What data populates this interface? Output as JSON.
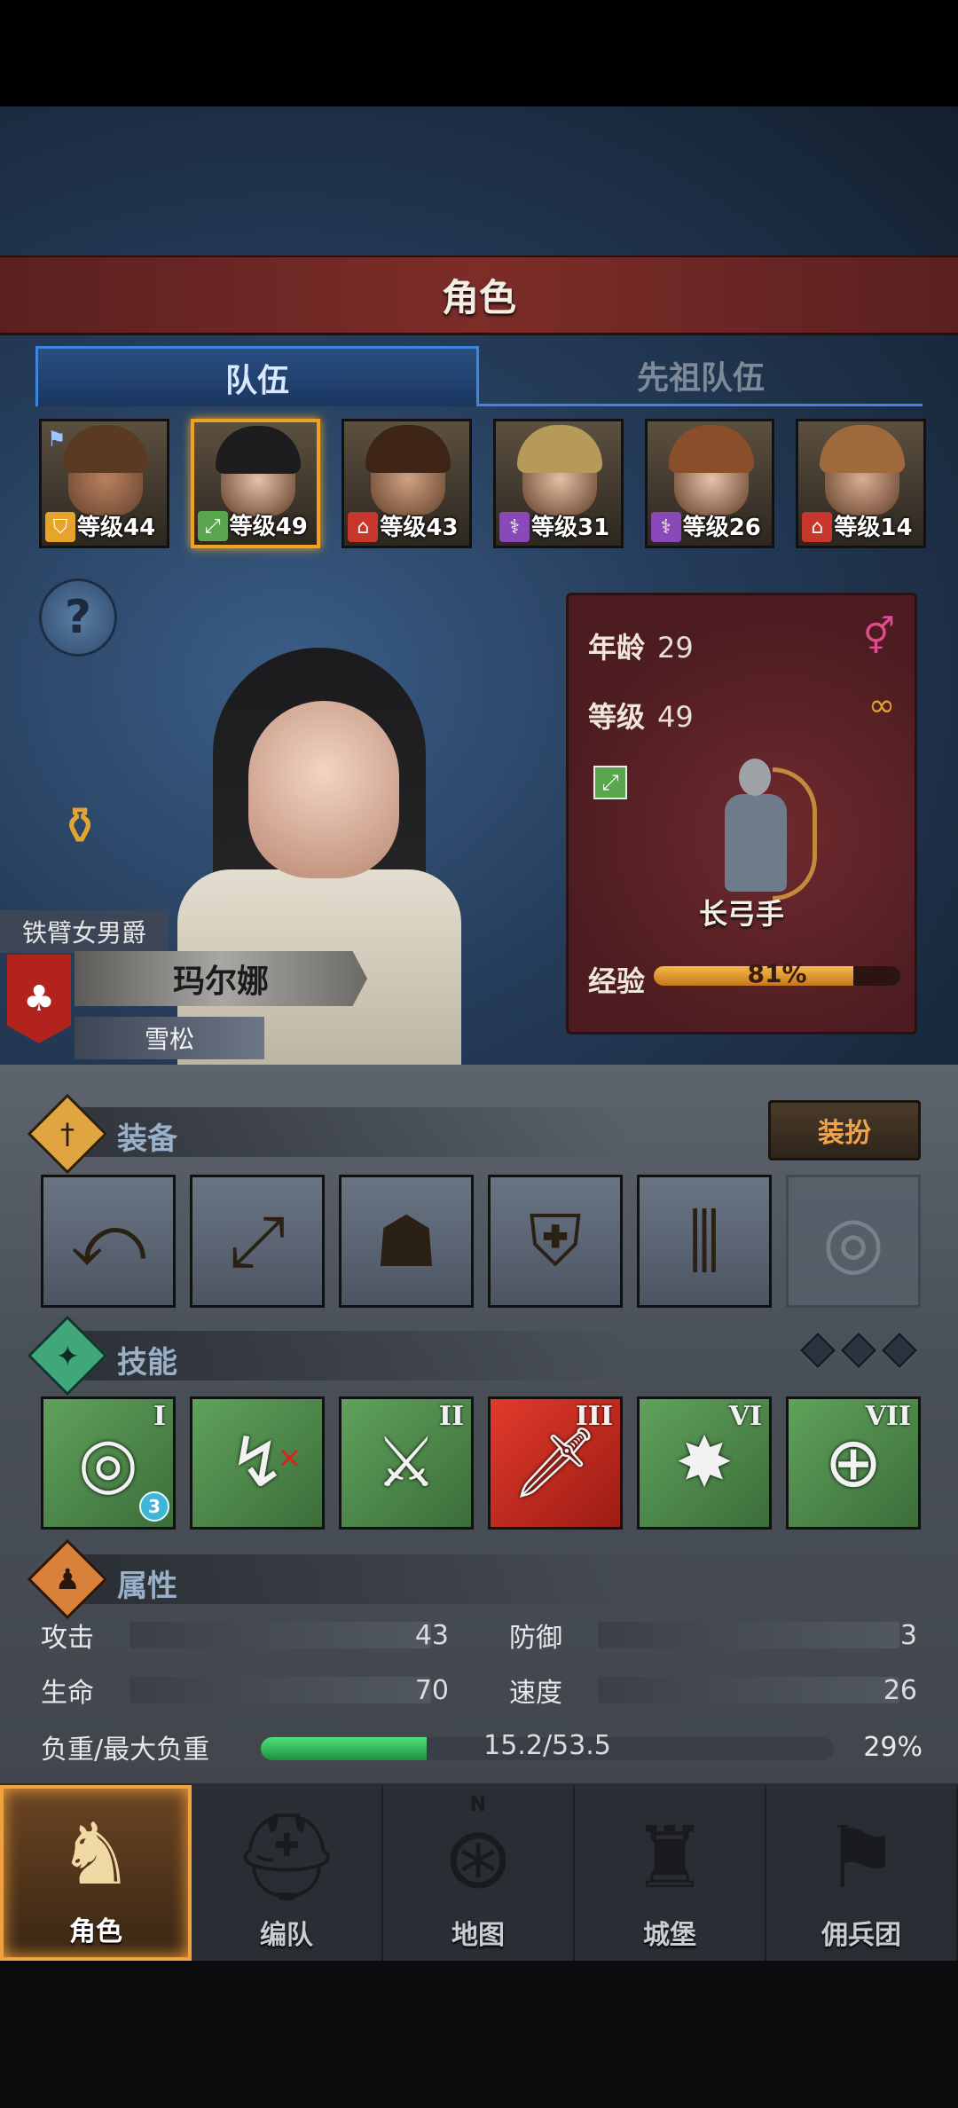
{
  "screen_title": "角色",
  "tabs": [
    {
      "label": "队伍",
      "active": true
    },
    {
      "label": "先祖队伍",
      "active": false
    }
  ],
  "party": [
    {
      "level_text": "等级44",
      "class_icon": "shield-icon",
      "class_color": "#e6a52a",
      "team_leader": true,
      "selected": false,
      "hair": "#5a3a22",
      "skin": "#b9815e"
    },
    {
      "level_text": "等级49",
      "class_icon": "bow-icon",
      "class_color": "#5aa64e",
      "team_leader": false,
      "selected": true,
      "hair": "#1d1d1f",
      "skin": "#e4c1ab"
    },
    {
      "level_text": "等级43",
      "class_icon": "house-icon",
      "class_color": "#c8372c",
      "team_leader": false,
      "selected": false,
      "hair": "#3d2415",
      "skin": "#d0a283"
    },
    {
      "level_text": "等级31",
      "class_icon": "staff-icon",
      "class_color": "#8a49b8",
      "team_leader": false,
      "selected": false,
      "hair": "#b59a5a",
      "skin": "#e2c0a4"
    },
    {
      "level_text": "等级26",
      "class_icon": "staff-icon",
      "class_color": "#8a49b8",
      "team_leader": false,
      "selected": false,
      "hair": "#8a4e2a",
      "skin": "#e6c3aa"
    },
    {
      "level_text": "等级14",
      "class_icon": "house-icon",
      "class_color": "#c8372c",
      "team_leader": false,
      "selected": false,
      "hair": "#a06a3c",
      "skin": "#d8ae92"
    }
  ],
  "character": {
    "title": "铁臂女男爵",
    "name": "玛尔娜",
    "house": "雪松",
    "age_label": "年龄",
    "age": "29",
    "level_label": "等级",
    "level": "49",
    "gender_icon": "female-icon",
    "class": "长弓手",
    "xp_label": "经验",
    "xp_percent": 81,
    "xp_text": "81%"
  },
  "equipment": {
    "title": "装备",
    "dress_button": "装扮",
    "slots": [
      {
        "icon": "longbow-icon"
      },
      {
        "icon": "bow-icon"
      },
      {
        "icon": "hood-icon"
      },
      {
        "icon": "tunic-icon"
      },
      {
        "icon": "boots-icon"
      },
      {
        "icon": "ring-slot-empty-icon",
        "empty": true
      }
    ]
  },
  "skills": {
    "title": "技能",
    "items": [
      {
        "icon": "target-arrow-icon",
        "rank": "I",
        "badge": "3"
      },
      {
        "icon": "dodge-icon",
        "rank": "",
        "crossed": true
      },
      {
        "icon": "crossed-swords-icon",
        "rank": "II"
      },
      {
        "icon": "sword-icon",
        "rank": "III",
        "red": true
      },
      {
        "icon": "burst-icon",
        "rank": "VI"
      },
      {
        "icon": "crosshair-icon",
        "rank": "VII"
      }
    ]
  },
  "attributes": {
    "title": "属性",
    "attack_label": "攻击",
    "attack": "43",
    "defense_label": "防御",
    "defense": "3",
    "hp_label": "生命",
    "hp": "70",
    "speed_label": "速度",
    "speed": "26",
    "load_label": "负重/最大负重",
    "load_text": "15.2/53.5",
    "load_percent_text": "29%",
    "load_fraction": 0.29
  },
  "nav": [
    {
      "label": "角色",
      "icon": "knight-icon",
      "active": true
    },
    {
      "label": "编队",
      "icon": "helmet-icon",
      "active": false
    },
    {
      "label": "地图",
      "icon": "compass-map-icon",
      "active": false
    },
    {
      "label": "城堡",
      "icon": "castle-icon",
      "active": false
    },
    {
      "label": "佣兵团",
      "icon": "mercenary-icon",
      "active": false
    }
  ],
  "compass_letter": "N"
}
